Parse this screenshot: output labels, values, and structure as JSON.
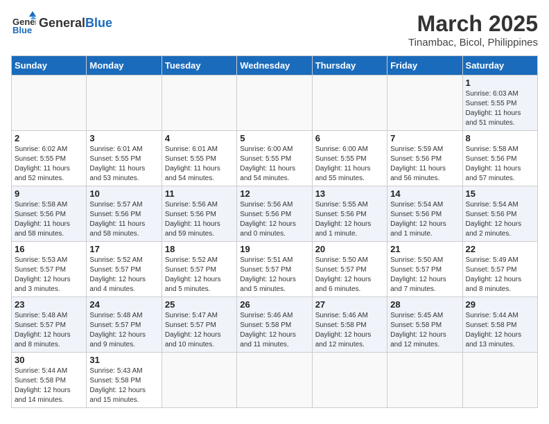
{
  "logo": {
    "text_general": "General",
    "text_blue": "Blue"
  },
  "title": "March 2025",
  "subtitle": "Tinambac, Bicol, Philippines",
  "headers": [
    "Sunday",
    "Monday",
    "Tuesday",
    "Wednesday",
    "Thursday",
    "Friday",
    "Saturday"
  ],
  "weeks": [
    [
      {
        "day": "",
        "info": ""
      },
      {
        "day": "",
        "info": ""
      },
      {
        "day": "",
        "info": ""
      },
      {
        "day": "",
        "info": ""
      },
      {
        "day": "",
        "info": ""
      },
      {
        "day": "",
        "info": ""
      },
      {
        "day": "1",
        "info": "Sunrise: 6:03 AM\nSunset: 5:55 PM\nDaylight: 11 hours\nand 51 minutes."
      }
    ],
    [
      {
        "day": "2",
        "info": "Sunrise: 6:02 AM\nSunset: 5:55 PM\nDaylight: 11 hours\nand 52 minutes."
      },
      {
        "day": "3",
        "info": "Sunrise: 6:01 AM\nSunset: 5:55 PM\nDaylight: 11 hours\nand 53 minutes."
      },
      {
        "day": "4",
        "info": "Sunrise: 6:01 AM\nSunset: 5:55 PM\nDaylight: 11 hours\nand 54 minutes."
      },
      {
        "day": "5",
        "info": "Sunrise: 6:00 AM\nSunset: 5:55 PM\nDaylight: 11 hours\nand 54 minutes."
      },
      {
        "day": "6",
        "info": "Sunrise: 6:00 AM\nSunset: 5:55 PM\nDaylight: 11 hours\nand 55 minutes."
      },
      {
        "day": "7",
        "info": "Sunrise: 5:59 AM\nSunset: 5:56 PM\nDaylight: 11 hours\nand 56 minutes."
      },
      {
        "day": "8",
        "info": "Sunrise: 5:58 AM\nSunset: 5:56 PM\nDaylight: 11 hours\nand 57 minutes."
      }
    ],
    [
      {
        "day": "9",
        "info": "Sunrise: 5:58 AM\nSunset: 5:56 PM\nDaylight: 11 hours\nand 58 minutes."
      },
      {
        "day": "10",
        "info": "Sunrise: 5:57 AM\nSunset: 5:56 PM\nDaylight: 11 hours\nand 58 minutes."
      },
      {
        "day": "11",
        "info": "Sunrise: 5:56 AM\nSunset: 5:56 PM\nDaylight: 11 hours\nand 59 minutes."
      },
      {
        "day": "12",
        "info": "Sunrise: 5:56 AM\nSunset: 5:56 PM\nDaylight: 12 hours\nand 0 minutes."
      },
      {
        "day": "13",
        "info": "Sunrise: 5:55 AM\nSunset: 5:56 PM\nDaylight: 12 hours\nand 1 minute."
      },
      {
        "day": "14",
        "info": "Sunrise: 5:54 AM\nSunset: 5:56 PM\nDaylight: 12 hours\nand 1 minute."
      },
      {
        "day": "15",
        "info": "Sunrise: 5:54 AM\nSunset: 5:56 PM\nDaylight: 12 hours\nand 2 minutes."
      }
    ],
    [
      {
        "day": "16",
        "info": "Sunrise: 5:53 AM\nSunset: 5:57 PM\nDaylight: 12 hours\nand 3 minutes."
      },
      {
        "day": "17",
        "info": "Sunrise: 5:52 AM\nSunset: 5:57 PM\nDaylight: 12 hours\nand 4 minutes."
      },
      {
        "day": "18",
        "info": "Sunrise: 5:52 AM\nSunset: 5:57 PM\nDaylight: 12 hours\nand 5 minutes."
      },
      {
        "day": "19",
        "info": "Sunrise: 5:51 AM\nSunset: 5:57 PM\nDaylight: 12 hours\nand 5 minutes."
      },
      {
        "day": "20",
        "info": "Sunrise: 5:50 AM\nSunset: 5:57 PM\nDaylight: 12 hours\nand 6 minutes."
      },
      {
        "day": "21",
        "info": "Sunrise: 5:50 AM\nSunset: 5:57 PM\nDaylight: 12 hours\nand 7 minutes."
      },
      {
        "day": "22",
        "info": "Sunrise: 5:49 AM\nSunset: 5:57 PM\nDaylight: 12 hours\nand 8 minutes."
      }
    ],
    [
      {
        "day": "23",
        "info": "Sunrise: 5:48 AM\nSunset: 5:57 PM\nDaylight: 12 hours\nand 8 minutes."
      },
      {
        "day": "24",
        "info": "Sunrise: 5:48 AM\nSunset: 5:57 PM\nDaylight: 12 hours\nand 9 minutes."
      },
      {
        "day": "25",
        "info": "Sunrise: 5:47 AM\nSunset: 5:57 PM\nDaylight: 12 hours\nand 10 minutes."
      },
      {
        "day": "26",
        "info": "Sunrise: 5:46 AM\nSunset: 5:58 PM\nDaylight: 12 hours\nand 11 minutes."
      },
      {
        "day": "27",
        "info": "Sunrise: 5:46 AM\nSunset: 5:58 PM\nDaylight: 12 hours\nand 12 minutes."
      },
      {
        "day": "28",
        "info": "Sunrise: 5:45 AM\nSunset: 5:58 PM\nDaylight: 12 hours\nand 12 minutes."
      },
      {
        "day": "29",
        "info": "Sunrise: 5:44 AM\nSunset: 5:58 PM\nDaylight: 12 hours\nand 13 minutes."
      }
    ],
    [
      {
        "day": "30",
        "info": "Sunrise: 5:44 AM\nSunset: 5:58 PM\nDaylight: 12 hours\nand 14 minutes."
      },
      {
        "day": "31",
        "info": "Sunrise: 5:43 AM\nSunset: 5:58 PM\nDaylight: 12 hours\nand 15 minutes."
      },
      {
        "day": "",
        "info": ""
      },
      {
        "day": "",
        "info": ""
      },
      {
        "day": "",
        "info": ""
      },
      {
        "day": "",
        "info": ""
      },
      {
        "day": "",
        "info": ""
      }
    ]
  ]
}
